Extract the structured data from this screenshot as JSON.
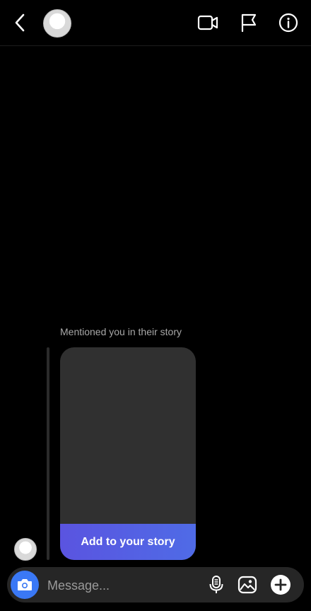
{
  "header": {
    "back_icon": "chevron-left-icon",
    "video_icon": "video-camera-icon",
    "flag_icon": "flag-icon",
    "info_icon": "info-icon"
  },
  "thread": {
    "mention_caption": "Mentioned you in their story",
    "add_story_label": "Add to your story",
    "accent": "#5a54e0"
  },
  "composer": {
    "placeholder": "Message...",
    "camera_icon": "camera-icon",
    "mic_icon": "microphone-icon",
    "gallery_icon": "gallery-icon",
    "plus_icon": "plus-circle-icon",
    "camera_color": "#3a78f5"
  }
}
